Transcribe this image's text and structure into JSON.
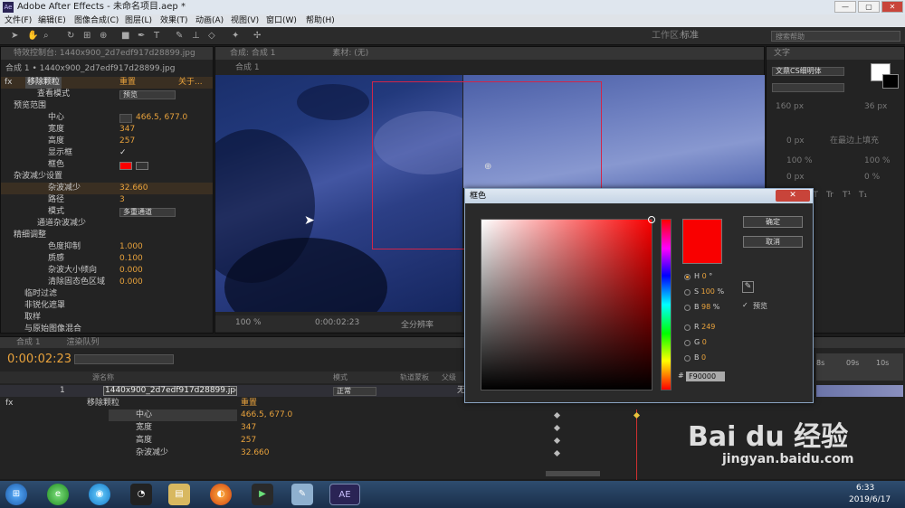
{
  "window": {
    "title": "Adobe After Effects - 未命名项目.aep *",
    "logo": "Ae",
    "btn_min": "—",
    "btn_max": "▢",
    "btn_close": "✕"
  },
  "menu": [
    "文件(F)",
    "编辑(E)",
    "图像合成(C)",
    "图层(L)",
    "效果(T)",
    "动画(A)",
    "视图(V)",
    "窗口(W)",
    "帮助(H)"
  ],
  "toolbar": {
    "workspace_label": "工作区:",
    "workspace_value": "标准",
    "search_placeholder": "搜索帮助"
  },
  "effects_panel": {
    "tab": "特效控制台: 1440x900_2d7edf917d28899.jpg",
    "header": "合成 1 • 1440x900_2d7edf917d28899.jpg",
    "effect_name": "移除颗粒",
    "reset": "重置",
    "about": "关于...",
    "rows": [
      {
        "label": "查看模式",
        "value": "预览"
      },
      {
        "label": "预览范围",
        "value": ""
      },
      {
        "label": "中心",
        "value": "466.5, 677.0"
      },
      {
        "label": "宽度",
        "value": "347"
      },
      {
        "label": "高度",
        "value": "257"
      },
      {
        "label": "显示框",
        "value": "✓"
      },
      {
        "label": "框色",
        "value": ""
      },
      {
        "label": "杂波减少设置",
        "value": ""
      },
      {
        "label": "杂波减少",
        "value": "32.660"
      },
      {
        "label": "路径",
        "value": "3"
      },
      {
        "label": "模式",
        "value": "多重通道"
      },
      {
        "label": "通道杂波减少",
        "value": ""
      },
      {
        "label": "精细调整",
        "value": ""
      },
      {
        "label": "色度抑制",
        "value": "1.000"
      },
      {
        "label": "质感",
        "value": "0.100"
      },
      {
        "label": "杂波大小倾向",
        "value": "0.000"
      },
      {
        "label": "清除固态色区域",
        "value": "0.000"
      },
      {
        "label": "临时过滤",
        "value": ""
      },
      {
        "label": "非锐化遮罩",
        "value": ""
      },
      {
        "label": "取样",
        "value": ""
      },
      {
        "label": "与原始图像混合",
        "value": ""
      }
    ]
  },
  "comp_panel": {
    "tab": "合成: 合成 1",
    "footage_tab": "素材: (无)",
    "comp_name": "合成 1",
    "zoom": "100 %",
    "timecode": "0:00:02:23",
    "resolution": "全分辨率"
  },
  "text_panel": {
    "tab": "文字",
    "font": "文鼎CS细明体",
    "size1": "160 px",
    "size2": "36 px",
    "tracking": "0 px",
    "align": "在最边上填充",
    "vscale": "100 %",
    "hscale": "100 %",
    "baseline": "0 px",
    "tsume": "0 %",
    "styles": [
      "T",
      "T",
      "TT",
      "Tr",
      "T¹",
      "T₁"
    ]
  },
  "timeline": {
    "tab1": "合成 1",
    "tab2": "渲染队列",
    "timecode": "0:00:02:23",
    "search_placeholder": "",
    "col_source": "源名称",
    "col_mode": "模式",
    "col_trkmat": "轨道蒙板",
    "col_parent": "父级",
    "layer_num": "1",
    "layer_name": "1440x900_2d7edf917d28899.jpg",
    "layer_mode": "正常",
    "parent_value": "无",
    "effect_name": "移除颗粒",
    "reset": "重置",
    "props": [
      {
        "label": "中心",
        "value": "466.5, 677.0"
      },
      {
        "label": "宽度",
        "value": "347"
      },
      {
        "label": "高度",
        "value": "257"
      },
      {
        "label": "杂波减少",
        "value": "32.660"
      }
    ],
    "ruler": [
      "8s",
      "09s",
      "10s"
    ]
  },
  "color_dialog": {
    "title": "框色",
    "close": "✕",
    "ok": "确定",
    "cancel": "取消",
    "preview": "预览",
    "h": {
      "label": "H",
      "value": "0",
      "unit": "°"
    },
    "s": {
      "label": "S",
      "value": "100",
      "unit": "%"
    },
    "b": {
      "label": "B",
      "value": "98",
      "unit": "%"
    },
    "r": {
      "label": "R",
      "value": "249"
    },
    "g": {
      "label": "G",
      "value": "0"
    },
    "bb": {
      "label": "B",
      "value": "0"
    },
    "hex_label": "#",
    "hex": "F90000",
    "current_color": "#f90000"
  },
  "taskbar": {
    "time": "6:33",
    "date": "2019/6/17",
    "ae": "AE"
  },
  "watermark": {
    "brand": "Bai du 经验",
    "url": "jingyan.baidu.com"
  }
}
